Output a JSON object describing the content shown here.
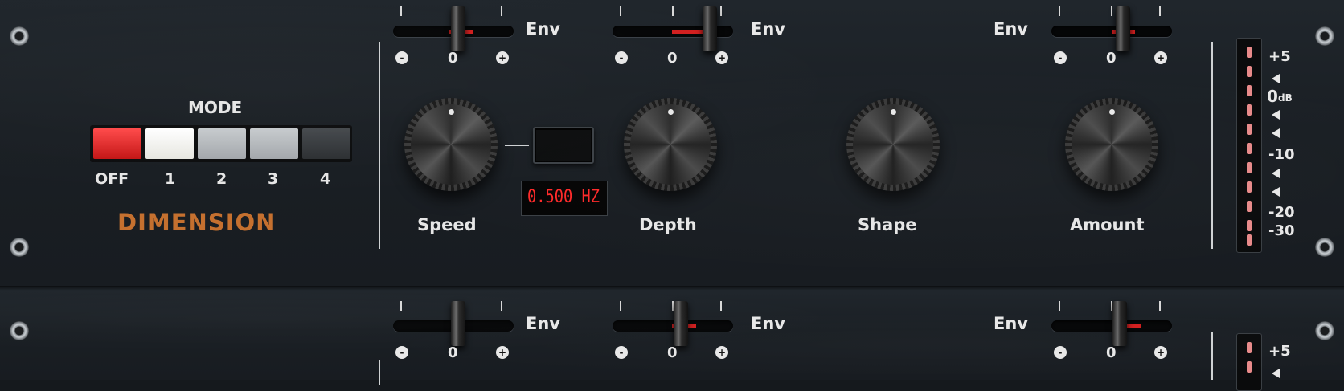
{
  "mode": {
    "title": "MODE",
    "buttons": [
      {
        "label": "OFF",
        "color": "#d11d1d"
      },
      {
        "label": "1",
        "color": "#f2f2ee"
      },
      {
        "label": "2",
        "color": "#b4b8bc"
      },
      {
        "label": "3",
        "color": "#b4b8bc"
      },
      {
        "label": "4",
        "color": "#3a3d40"
      }
    ]
  },
  "brand": {
    "name": "DIMENSION",
    "color": "#c5702f"
  },
  "knobs": {
    "speed": "Speed",
    "depth": "Depth",
    "shape": "Shape",
    "amount": "Amount"
  },
  "speed_display": {
    "value": "0.500 HZ",
    "color": "#ff2a2a"
  },
  "env_sliders": [
    {
      "label": "Env",
      "minus": "-",
      "zero": "0",
      "plus": "+"
    },
    {
      "label": "Env",
      "minus": "-",
      "zero": "0",
      "plus": "+"
    },
    {
      "label": "Env",
      "minus": "-",
      "zero": "0",
      "plus": "+"
    }
  ],
  "env_sliders_bottom": [
    {
      "label": "Env",
      "minus": "-",
      "zero": "0",
      "plus": "+"
    },
    {
      "label": "Env",
      "minus": "-",
      "zero": "0",
      "plus": "+"
    },
    {
      "label": "Env",
      "minus": "-",
      "zero": "0",
      "plus": "+"
    }
  ],
  "meter": {
    "labels": [
      "+5",
      "0",
      "dB",
      "-10",
      "-20",
      "-30"
    ]
  },
  "meter_bottom": {
    "labels": [
      "+5"
    ]
  }
}
